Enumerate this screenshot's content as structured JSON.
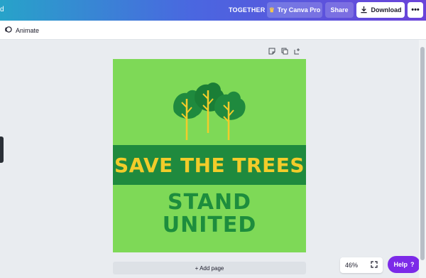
{
  "topbar": {
    "left_stub": "d",
    "together": "TOGETHER",
    "try_pro_label": "Try Canva Pro",
    "share_label": "Share",
    "download_label": "Download",
    "more_label": "•••",
    "gradient_start": "#27a3c9",
    "gradient_end": "#6a43d9"
  },
  "toolbar": {
    "animate_label": "Animate"
  },
  "design": {
    "headline": "SAVE THE TREES",
    "subline_1": "STAND",
    "subline_2": "UNITED",
    "background_color": "#7ed957",
    "banner_color": "#1f8a3e",
    "headline_color": "#f2cc2a",
    "subline_color": "#1d8d3d"
  },
  "footer": {
    "add_page_label": "+ Add page",
    "zoom_value": "46%",
    "help_label": "Help",
    "help_icon": "?"
  },
  "icons": {
    "page_tools": [
      "note-icon",
      "duplicate-icon",
      "add-page-icon"
    ]
  }
}
